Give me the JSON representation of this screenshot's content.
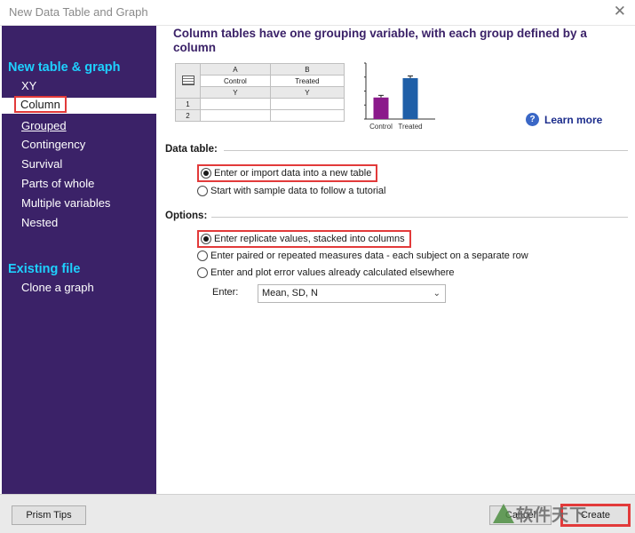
{
  "window": {
    "title": "New Data Table and Graph"
  },
  "sidebar": {
    "section_new": "New table & graph",
    "items": [
      {
        "label": "XY"
      },
      {
        "label": "Column"
      },
      {
        "label": "Grouped"
      },
      {
        "label": "Contingency"
      },
      {
        "label": "Survival"
      },
      {
        "label": "Parts of whole"
      },
      {
        "label": "Multiple variables"
      },
      {
        "label": "Nested"
      }
    ],
    "section_existing": "Existing file",
    "existing_items": [
      {
        "label": "Clone a graph"
      }
    ]
  },
  "main": {
    "heading": "Column tables have one grouping variable, with each group defined by a column",
    "preview_table": {
      "col_letters": [
        "A",
        "B"
      ],
      "col_titles": [
        "Control",
        "Treated"
      ],
      "col_sub": [
        "Y",
        "Y"
      ],
      "rows": [
        "1",
        "2"
      ]
    },
    "learn_more": "Learn more",
    "data_table": {
      "label": "Data table:",
      "options": [
        "Enter or import data into a new table",
        "Start with sample data to follow a tutorial"
      ],
      "selected": 0
    },
    "options": {
      "label": "Options:",
      "choices": [
        "Enter replicate values, stacked into columns",
        "Enter paired or repeated measures data - each subject on a separate row",
        "Enter and plot error values already calculated elsewhere"
      ],
      "selected": 0,
      "enter_label": "Enter:",
      "enter_value": "Mean, SD, N"
    }
  },
  "chart_data": {
    "type": "bar",
    "categories": [
      "Control",
      "Treated"
    ],
    "values": [
      0.5,
      0.95
    ],
    "errors": [
      0.05,
      0.05
    ],
    "colors": [
      "#8b1a8b",
      "#1f5fa8"
    ],
    "ylim": [
      0,
      1.3
    ]
  },
  "footer": {
    "tips": "Prism Tips",
    "cancel": "Cancel",
    "create": "Create",
    "watermark": "软件天下"
  },
  "colors": {
    "sidebar_bg": "#3b2268",
    "section_accent": "#1ed1ff",
    "highlight": "#e23a3a"
  }
}
